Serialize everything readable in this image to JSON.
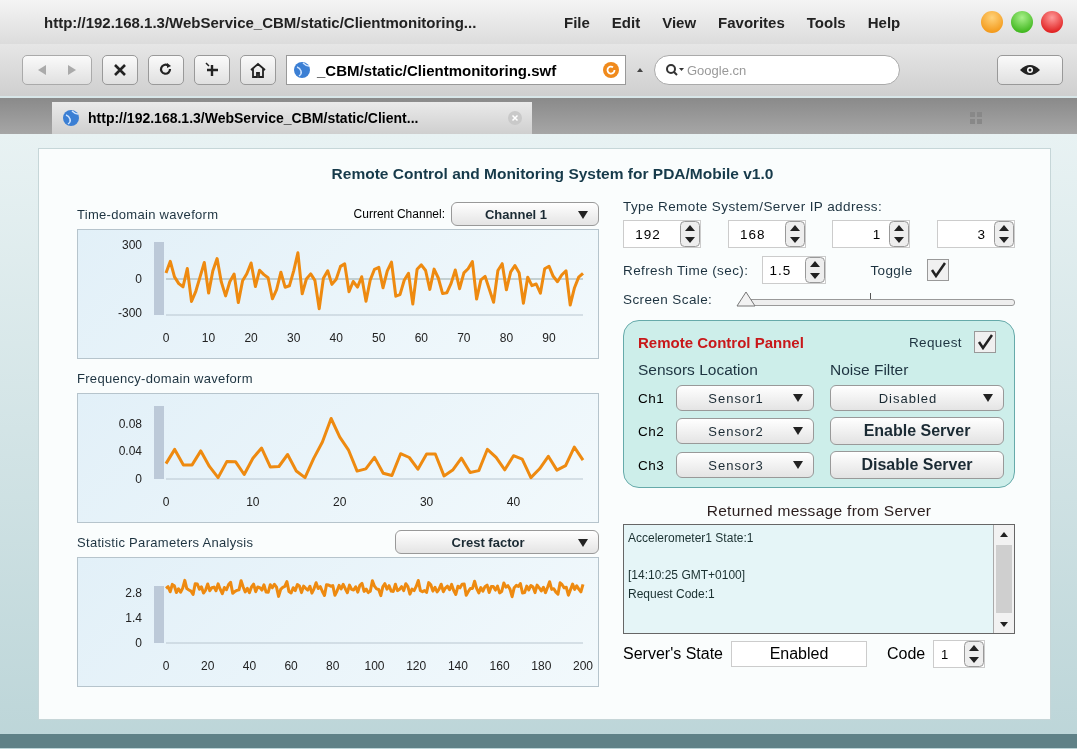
{
  "window": {
    "title": "http://192.168.1.3/WebService_CBM/static/Clientmonitoring..."
  },
  "menu": [
    {
      "label": "File"
    },
    {
      "label": "Edit"
    },
    {
      "label": "View"
    },
    {
      "label": "Favorites"
    },
    {
      "label": "Tools"
    },
    {
      "label": "Help"
    }
  ],
  "toolbar": {
    "address": "_CBM/static/Clientmonitoring.swf",
    "search_placeholder": "Google.cn"
  },
  "tabs": [
    {
      "label": "http://192.168.1.3/WebService_CBM/static/Client...",
      "selected": true
    }
  ],
  "app": {
    "title": "Remote Control and Monitoring System for PDA/Mobile  v1.0",
    "charts": [
      {
        "kind": "time",
        "title": "Time-domain waveform",
        "select_label": "Current Channel:",
        "select_value": "Channel 1",
        "yticks": [
          "300",
          "0",
          "-300"
        ],
        "xticks": [
          "0",
          "10",
          "20",
          "30",
          "40",
          "50",
          "60",
          "70",
          "80",
          "90"
        ]
      },
      {
        "kind": "spectrum",
        "title": "Frequency-domain waveform",
        "yticks": [
          "0.08",
          "0.04",
          "0"
        ],
        "xticks": [
          "0",
          "10",
          "20",
          "30",
          "40"
        ]
      },
      {
        "kind": "stat",
        "title": "Statistic Parameters Analysis",
        "select_value": "Crest factor",
        "yticks": [
          "2.8",
          "1.4",
          "0"
        ],
        "xticks": [
          "0",
          "20",
          "40",
          "60",
          "80",
          "100",
          "120",
          "140",
          "160",
          "180",
          "200"
        ]
      }
    ],
    "ip_label": "Type Remote System/Server IP address:",
    "ip_fields": [
      "192",
      "168",
      "1",
      "3"
    ],
    "refresh_label": "Refresh Time (sec):",
    "refresh_value": "1.5",
    "toggle": {
      "label": "Toggle",
      "checked": true
    },
    "scale": {
      "label": "Screen Scale:",
      "level": 0
    },
    "remote": {
      "title": "Remote Control Pannel",
      "request": {
        "label": "Request",
        "checked": true
      },
      "sensors_heading": "Sensors Location",
      "filter_heading": "Noise Filter",
      "channels": [
        {
          "label": "Ch1",
          "sensor": "Sensor1"
        },
        {
          "label": "Ch2",
          "sensor": "Sensor2"
        },
        {
          "label": "Ch3",
          "sensor": "Sensor3"
        }
      ],
      "filter_value": "Disabled",
      "buttons": [
        "Enable Server",
        "Disable Server"
      ]
    },
    "messages": {
      "title": "Returned message from Server",
      "blocks": [
        [
          "Accelerometer1 State:1"
        ],
        [
          "[14:10:25 GMT+0100]",
          "Request Code:1"
        ]
      ]
    },
    "server_state_label": "Server's State",
    "server_state": "Enabled",
    "code_label": "Code",
    "code_value": "1"
  }
}
